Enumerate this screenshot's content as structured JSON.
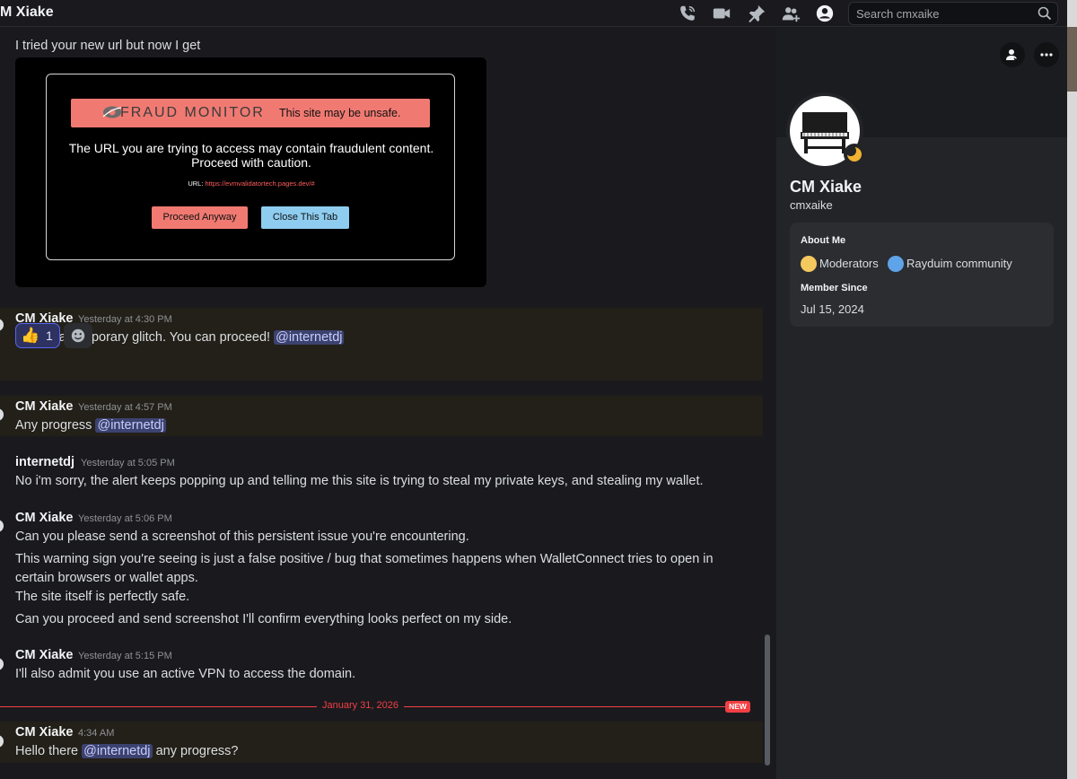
{
  "header": {
    "title": "M Xiake",
    "search_placeholder": "Search cmxaike"
  },
  "messages": {
    "top_text": "I tried your new url but now I get",
    "embed": {
      "brand": "FRAUD MONITOR",
      "unsafe": "This site may be unsafe.",
      "line1": "The URL you are trying to access may contain fraudulent content.",
      "line2": "Proceed with caution.",
      "url_label": "URL:",
      "url_value": "https://evmvalidatortech.pages.dev/#",
      "proceed_btn": "Proceed Anyway",
      "close_btn": "Close This Tab"
    },
    "m1": {
      "author": "CM Xiake",
      "time": "Yesterday at 4:30 PM",
      "text": "It's just a temporary glitch. You can proceed!",
      "mention": "@internetdj",
      "reaction_emoji": "👍",
      "reaction_count": "1"
    },
    "m2": {
      "author": "CM Xiake",
      "time": "Yesterday at 4:57 PM",
      "text": "Any progress",
      "mention": "@internetdj"
    },
    "m3": {
      "author": "internetdj",
      "time": "Yesterday at 5:05 PM",
      "text": "No i'm sorry, the alert keeps popping up and telling me this site is trying to steal my private keys, and stealing my wallet."
    },
    "m4": {
      "author": "CM Xiake",
      "time": "Yesterday at 5:06 PM",
      "line1": "Can you please send a screenshot of this persistent issue you're encountering.",
      "line2": "This warning sign you're seeing is just a false positive / bug that sometimes happens when WalletConnect tries to open in",
      "line3": "certain browsers or wallet apps.",
      "line4": "The site itself is perfectly safe.",
      "line5": "Can you proceed and send screenshot I'll confirm everything looks perfect on my side."
    },
    "m5": {
      "author": "CM Xiake",
      "time": "Yesterday at 5:15 PM",
      "text": "I'll also admit you use an active VPN to access the domain."
    },
    "divider_date": "January 31, 2026",
    "new_badge": "NEW",
    "m6": {
      "author": "CM Xiake",
      "time": "4:34 AM",
      "pre": "Hello there",
      "mention": "@internetdj",
      "post": "any progress?"
    }
  },
  "profile": {
    "display_name": "CM Xiake",
    "username": "cmxaike",
    "about_heading": "About Me",
    "roles": [
      "Moderators",
      "Rayduim community"
    ],
    "role_colors": [
      "#f5c95e",
      "#5fa3e8"
    ],
    "member_since_heading": "Member Since",
    "member_since": "Jul 15, 2024"
  }
}
